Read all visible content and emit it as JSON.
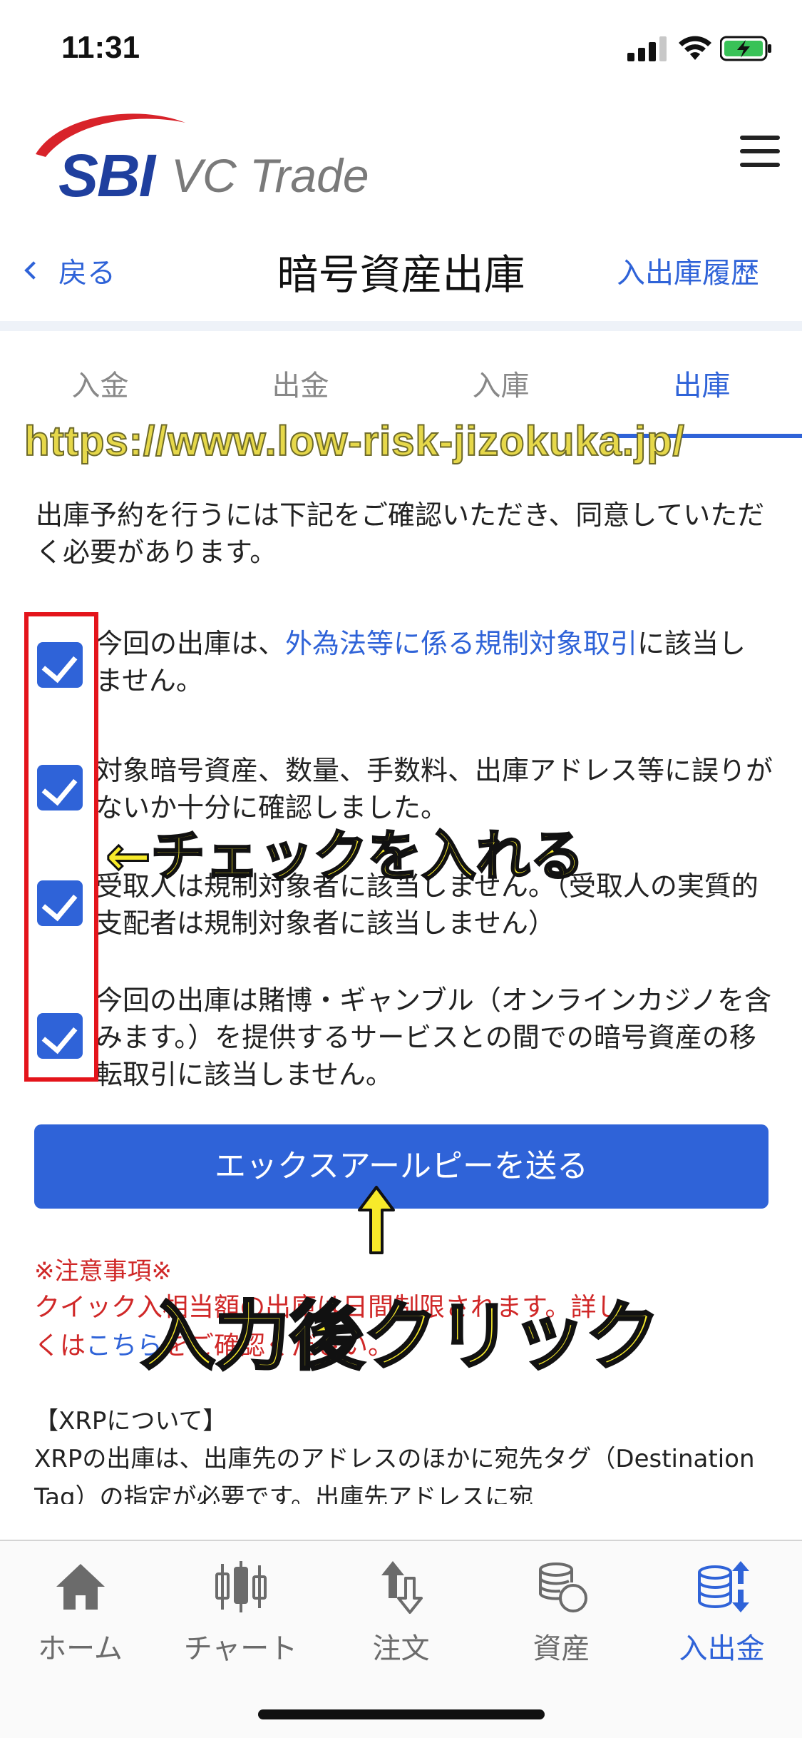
{
  "status": {
    "time": "11:31"
  },
  "brand": {
    "logo_text_main": "SBI",
    "logo_text_sub": "VC Trade"
  },
  "nav": {
    "back_label": "戻る",
    "title": "暗号資産出庫",
    "history_label": "入出庫履歴"
  },
  "tabs": [
    {
      "label": "入金"
    },
    {
      "label": "出金"
    },
    {
      "label": "入庫"
    },
    {
      "label": "出庫"
    }
  ],
  "watermark": "https://www.low-risk-jizokuka.jp/",
  "intro": "出庫予約を行うには下記をご確認いただき、同意していただく必要があります。",
  "agreements": [
    {
      "before": "今回の出庫は、",
      "link": "外為法等に係る規制対象取引",
      "after": "に該当しません。",
      "checked": true
    },
    {
      "text": "対象暗号資産、数量、手数料、出庫アドレス等に誤りがないか十分に確認しました。",
      "checked": true
    },
    {
      "text": "受取人は規制対象者に該当しません。（受取人の実質的支配者は規制対象者に該当しません）",
      "checked": true
    },
    {
      "text": "今回の出庫は賭博・ギャンブル（オンラインカジノを含みます。）を提供するサービスとの間での暗号資産の移転取引に該当しません。",
      "checked": true
    }
  ],
  "annotations": {
    "check": "←チェックを入れる",
    "arrow": "↑",
    "click": "入力後クリック"
  },
  "send_button": "エックスアールピーを送る",
  "notice": {
    "title": "※注意事項※",
    "line1": "クイック入",
    "line1_b": "相当額の",
    "line1_c": "出庫は",
    "line1_d": "日間制限されます。詳し",
    "line2_a": "くは",
    "line2_link": "こちら",
    "line2_b": "をご確認ください。"
  },
  "xrp": {
    "title": "【XRPについて】",
    "text": "XRPの出庫は、出庫先のアドレスのほかに宛先タグ（Destination Tag）の指定が必要です。出庫先アドレスに宛"
  },
  "tabbar": [
    {
      "label": "ホーム",
      "icon": "home-icon"
    },
    {
      "label": "チャート",
      "icon": "candlestick-chart-icon"
    },
    {
      "label": "注文",
      "icon": "order-arrows-icon"
    },
    {
      "label": "資産",
      "icon": "coins-icon"
    },
    {
      "label": "入出金",
      "icon": "deposit-withdraw-icon",
      "active": true
    }
  ],
  "colors": {
    "accent": "#2f63d8",
    "warning": "#d02828",
    "annotation_frame": "#e4141b",
    "annotation_text": "#f7ea2a"
  }
}
